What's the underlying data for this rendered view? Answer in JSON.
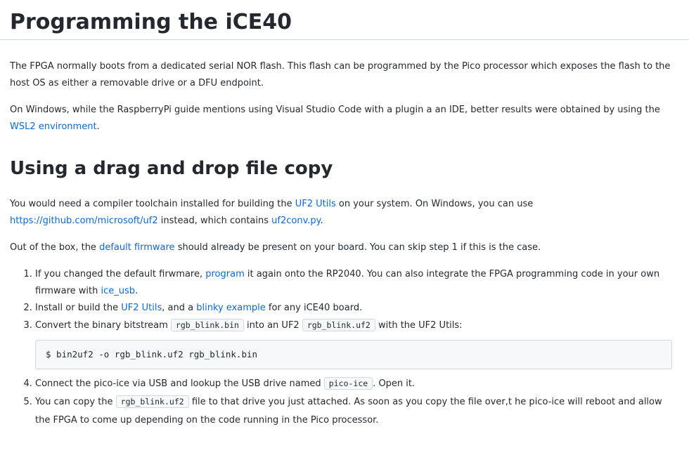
{
  "page_title": "Programming the iCE40",
  "intro": {
    "p1": "The FPGA normally boots from a dedicated serial NOR flash. This flash can be programmed by the Pico processor which exposes the flash to the host OS as either a removable drive or a DFU endpoint.",
    "p2_before": "On Windows, while the RaspberryPi guide mentions using Visual Studio Code with a plugin a an IDE, better results were obtained by using the ",
    "p2_link": "WSL2 environment",
    "p2_after": "."
  },
  "section": {
    "heading": "Using a drag and drop file copy",
    "p3_a": "You would need a compiler toolchain installed for building the ",
    "p3_link1": "UF2 Utils",
    "p3_b": " on your system. On Windows, you can use ",
    "p3_link2": "https://github.com/microsoft/uf2",
    "p3_c": " instead, which contains ",
    "p3_link3": "uf2conv.py",
    "p3_d": ".",
    "p4_a": "Out of the box, the ",
    "p4_link": "default firmware",
    "p4_b": " should already be present on your board. You can skip step 1 if this is the case."
  },
  "steps": {
    "s1_a": "If you changed the default firwmare, ",
    "s1_link1": "program",
    "s1_b": " it again onto the RP2040. You can also integrate the FPGA programming code in your own firmware with ",
    "s1_link2": "ice_usb",
    "s1_c": ".",
    "s2_a": "Install or build the ",
    "s2_link1": "UF2 Utils",
    "s2_b": ", and a ",
    "s2_link2": "blinky example",
    "s2_c": " for any iCE40 board.",
    "s3_a": "Convert the binary bitstream ",
    "s3_code1": "rgb_blink.bin",
    "s3_b": " into an UF2 ",
    "s3_code2": "rgb_blink.uf2",
    "s3_c": " with the UF2 Utils:",
    "s3_command": "$ bin2uf2 -o rgb_blink.uf2 rgb_blink.bin",
    "s4_a": "Connect the pico-ice via USB and lookup the USB drive named ",
    "s4_code": "pico-ice",
    "s4_b": ". Open it.",
    "s5_a": "You can copy the ",
    "s5_code": "rgb_blink.uf2",
    "s5_b": " file to that drive you just attached. As soon as you copy the file over,t he pico-ice will reboot and allow the FPGA to come up depending on the code running in the Pico processor."
  }
}
